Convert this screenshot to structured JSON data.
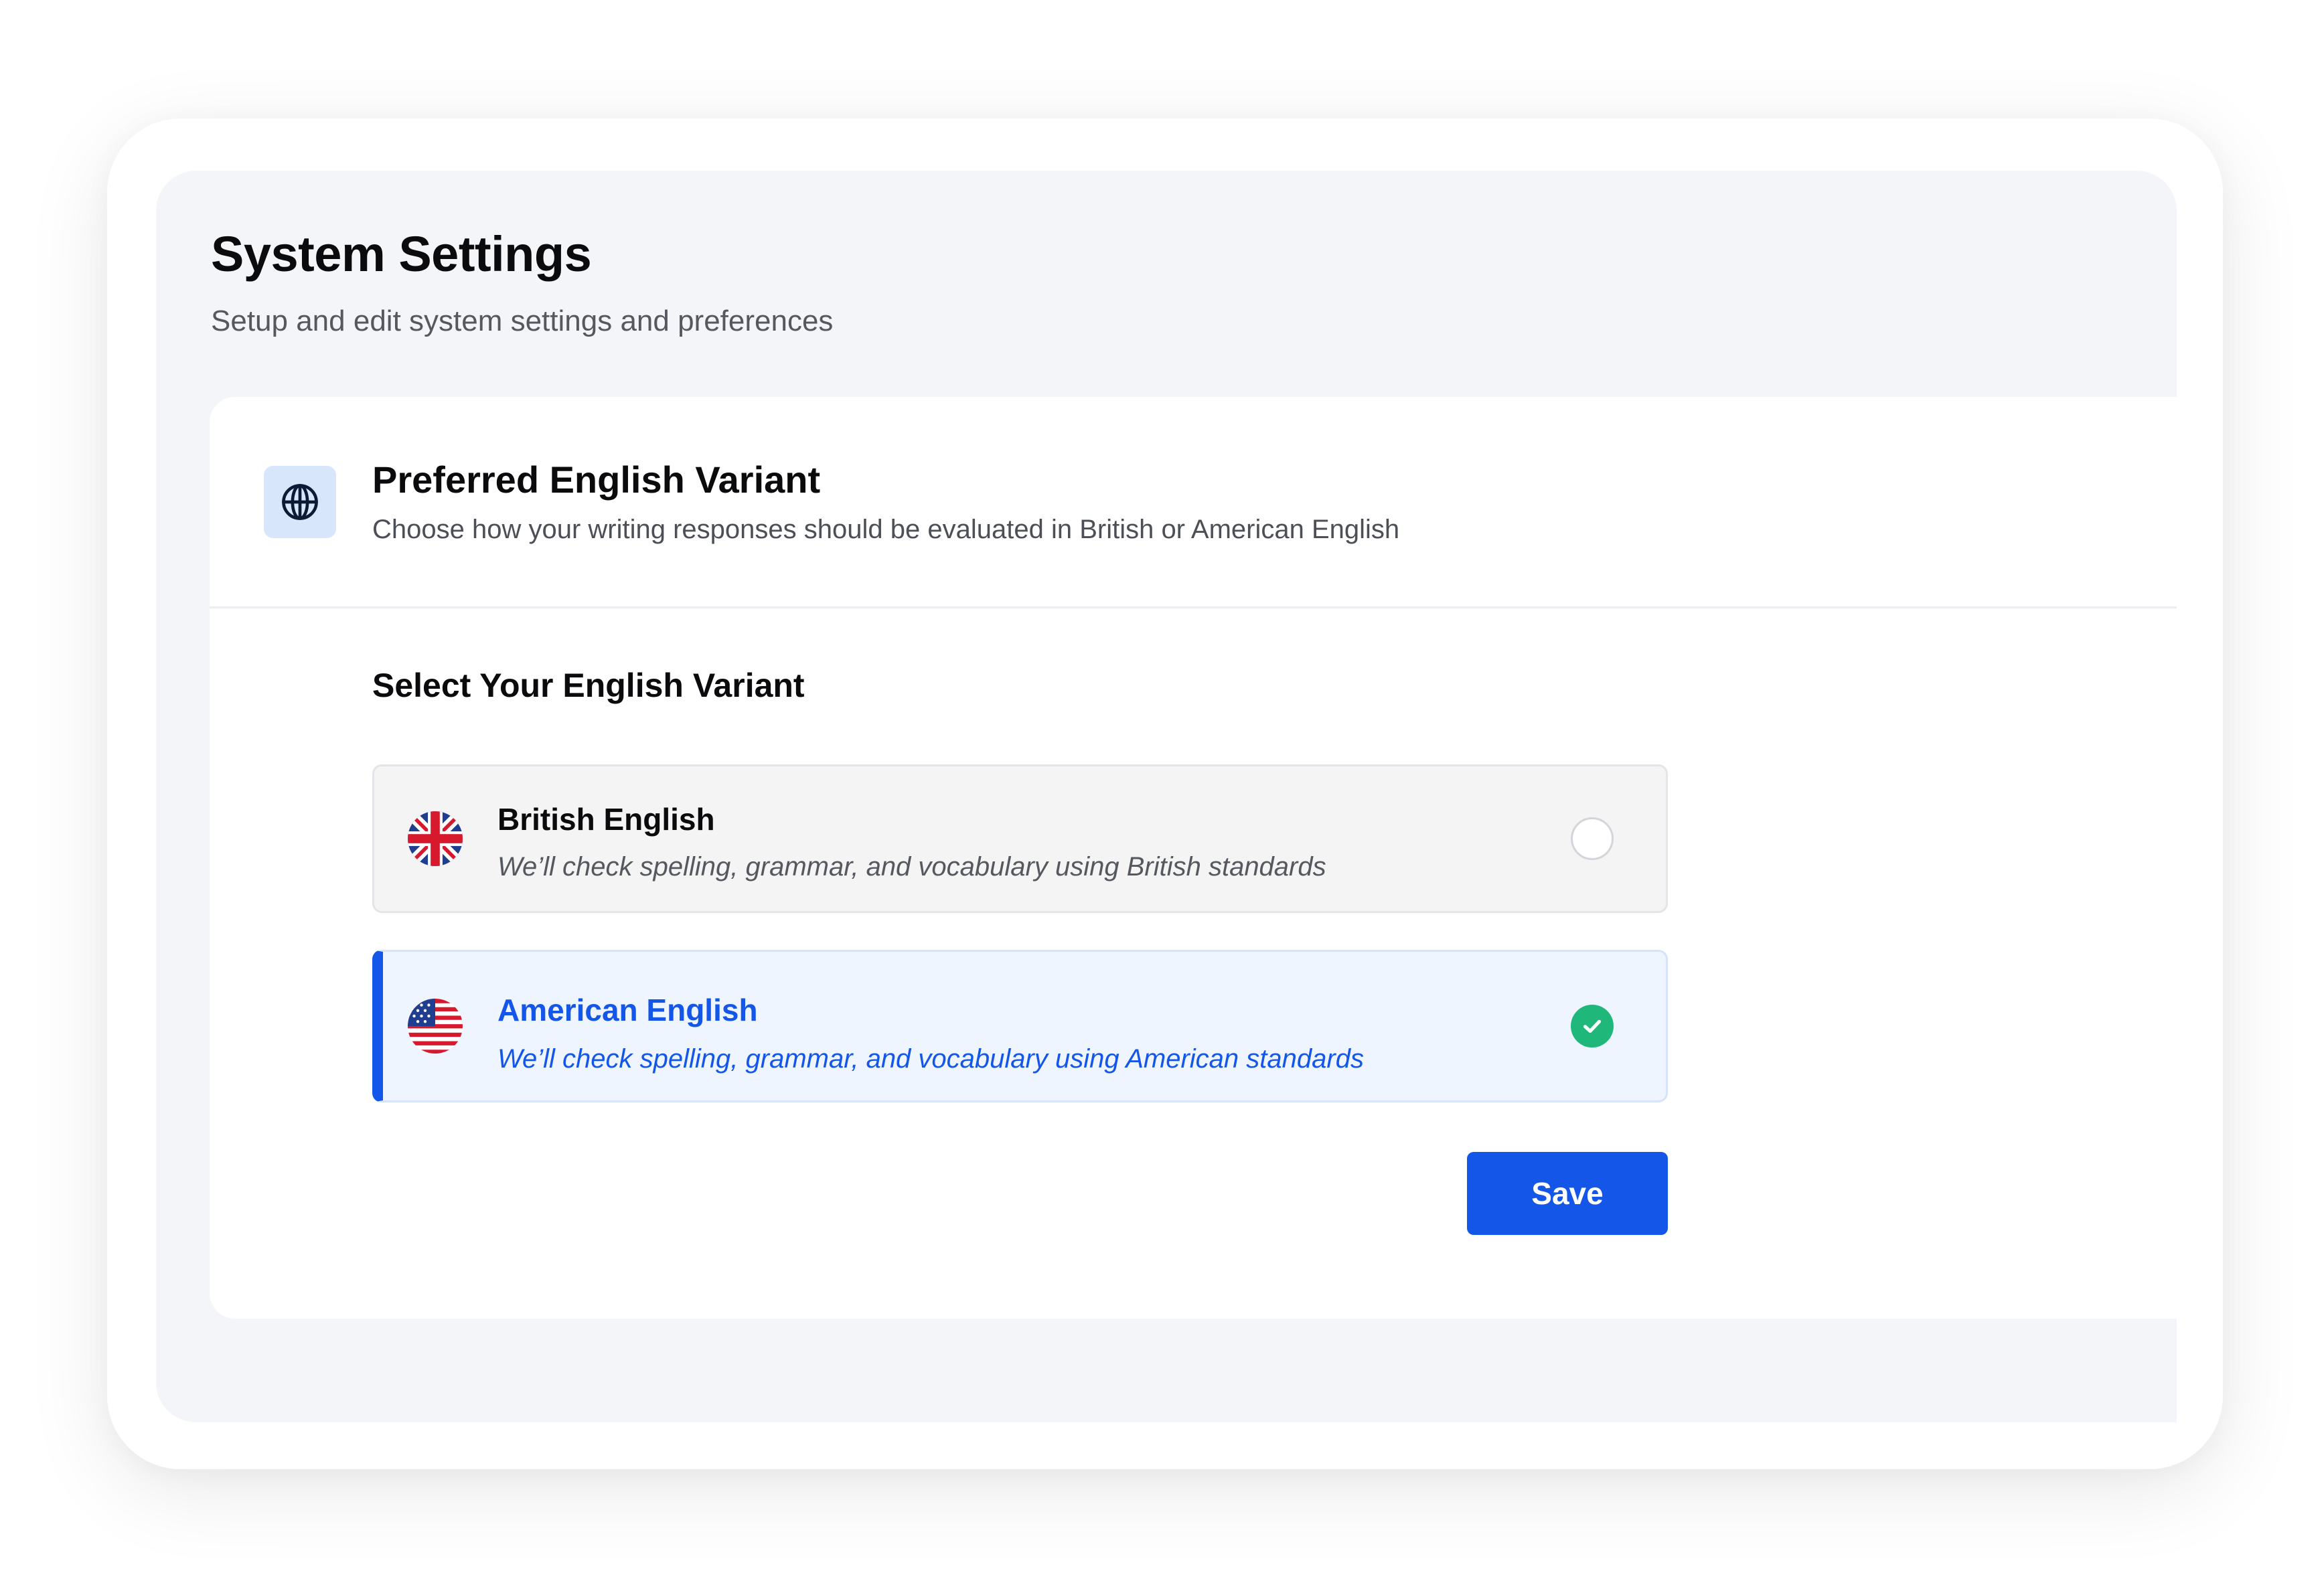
{
  "page": {
    "title": "System Settings",
    "subtitle": "Setup and edit system settings and preferences"
  },
  "card": {
    "icon": "globe-icon",
    "title": "Preferred English Variant",
    "description": "Choose how your writing responses should be evaluated in British or American English"
  },
  "selection": {
    "label": "Select Your English Variant",
    "options": [
      {
        "id": "british",
        "flag": "uk-flag-icon",
        "title": "British English",
        "description": "We’ll check spelling, grammar, and vocabulary using British standards",
        "selected": false
      },
      {
        "id": "american",
        "flag": "us-flag-icon",
        "title": "American English",
        "description": "We’ll check spelling, grammar, and vocabulary using American standards",
        "selected": true
      }
    ]
  },
  "actions": {
    "save_label": "Save"
  },
  "colors": {
    "accent": "#1456e8",
    "success": "#20b77a",
    "page_bg": "#f4f5f8",
    "selected_bg": "#eff5ff"
  }
}
